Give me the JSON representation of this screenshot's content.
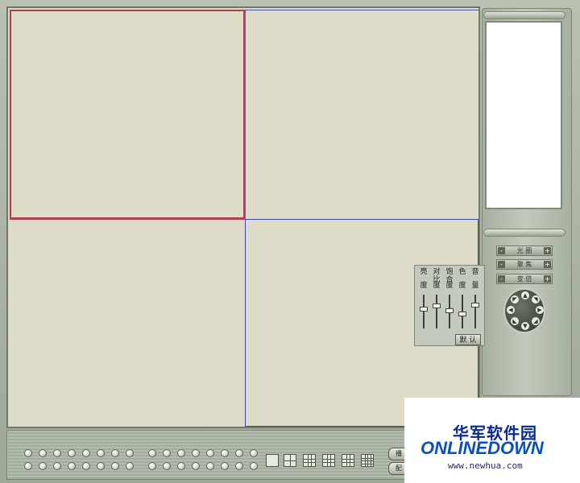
{
  "adjust_panel": {
    "labels": [
      {
        "top": "亮",
        "bottom": "度"
      },
      {
        "top": "对比",
        "bottom": "度"
      },
      {
        "top": "饱合",
        "bottom": "度"
      },
      {
        "top": "色",
        "bottom": "度"
      },
      {
        "top": "音",
        "bottom": "量"
      }
    ],
    "levels": [
      0.6,
      0.7,
      0.55,
      0.45,
      0.75
    ],
    "default_label": "默 认"
  },
  "ptz_controls": {
    "rows": [
      {
        "label": "光 圈",
        "minus": "-",
        "plus": "+"
      },
      {
        "label": "聚 焦",
        "minus": "-",
        "plus": "+"
      },
      {
        "label": "变 倍",
        "minus": "-",
        "plus": "+"
      }
    ]
  },
  "side_buttons": [
    "播",
    "配"
  ],
  "watermark": {
    "cn": "华军软件园",
    "logo": "ONLINEDOWN",
    "url": "www.newhua.com"
  },
  "colors": {
    "active_cell_border": "#b0404a",
    "selected_cell_border": "#3a48b8",
    "cell_background": "#dedcc8"
  },
  "layout_modes": [
    "layout-1-icon",
    "layout-4-icon",
    "layout-6-icon",
    "layout-8-icon",
    "layout-9-icon",
    "layout-16-icon"
  ]
}
